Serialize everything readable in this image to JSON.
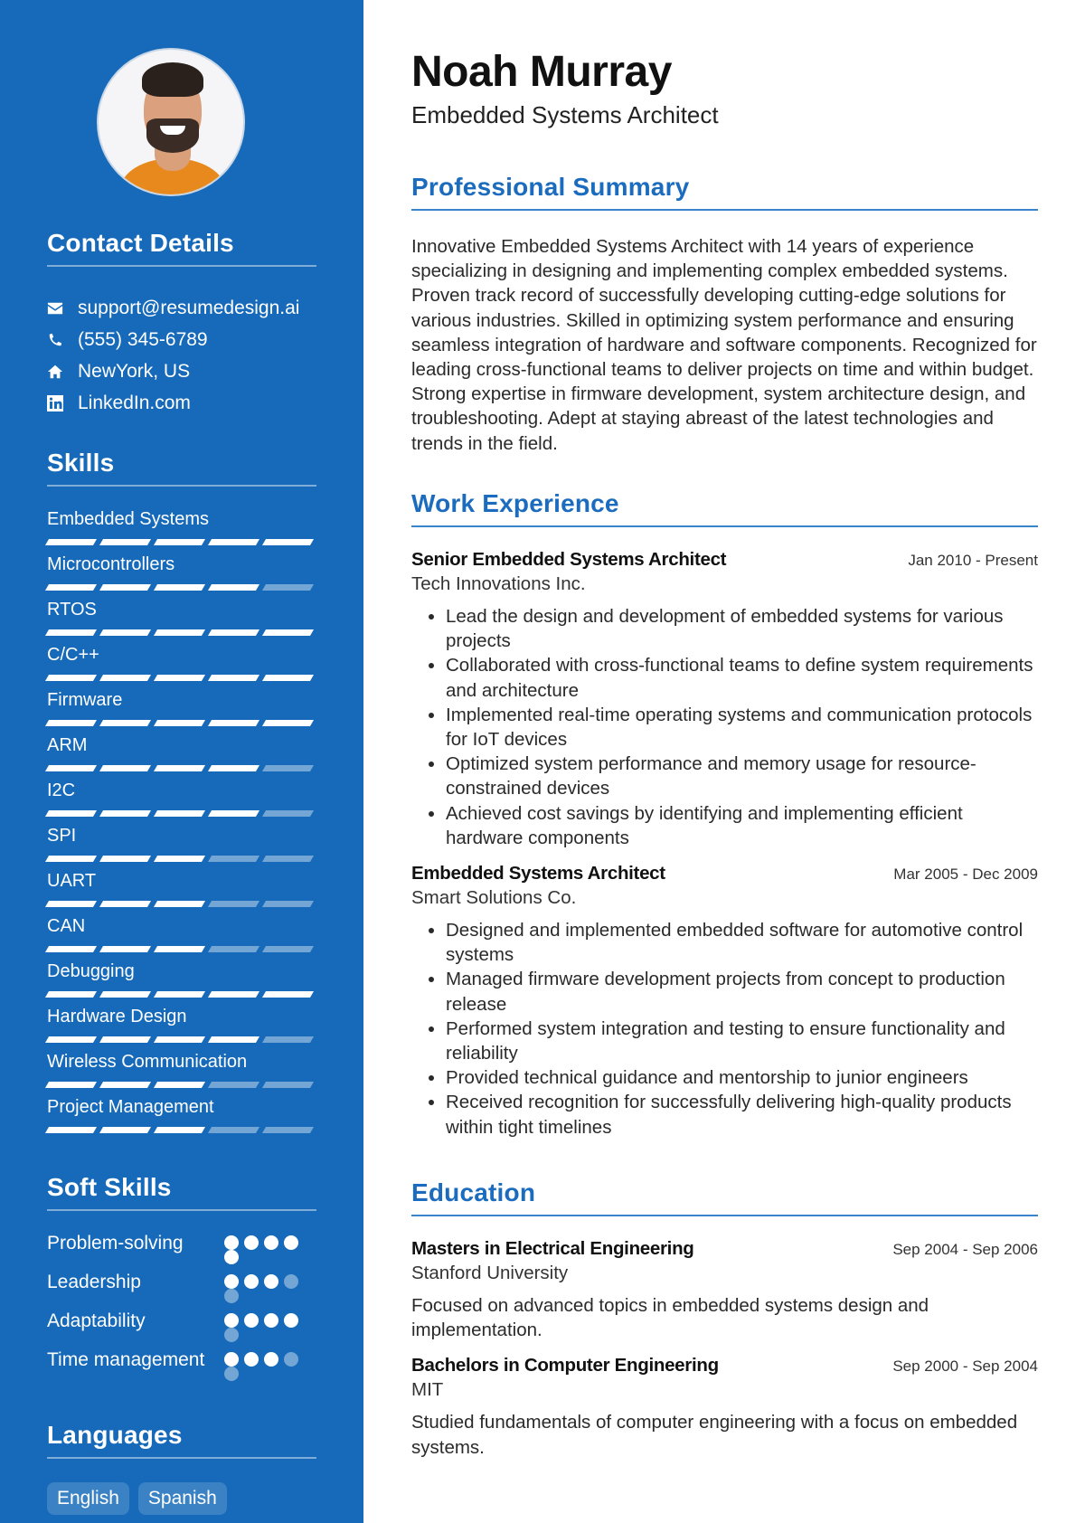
{
  "profile": {
    "name": "Noah Murray",
    "role": "Embedded Systems Architect",
    "photo_alt": "Profile photo of a smiling man with a beard wearing an orange shirt"
  },
  "contact": {
    "title": "Contact Details",
    "items": [
      {
        "icon": "envelope-icon",
        "text": "support@resumedesign.ai"
      },
      {
        "icon": "phone-icon",
        "text": "(555) 345-6789"
      },
      {
        "icon": "home-icon",
        "text": "NewYork, US"
      },
      {
        "icon": "linkedin-icon",
        "text": "LinkedIn.com"
      }
    ]
  },
  "skills": {
    "title": "Skills",
    "max": 5,
    "items": [
      {
        "name": "Embedded Systems",
        "level": 5
      },
      {
        "name": "Microcontrollers",
        "level": 4
      },
      {
        "name": "RTOS",
        "level": 5
      },
      {
        "name": "C/C++",
        "level": 5
      },
      {
        "name": "Firmware",
        "level": 5
      },
      {
        "name": "ARM",
        "level": 4
      },
      {
        "name": "I2C",
        "level": 4
      },
      {
        "name": "SPI",
        "level": 3
      },
      {
        "name": "UART",
        "level": 3
      },
      {
        "name": "CAN",
        "level": 3
      },
      {
        "name": "Debugging",
        "level": 5
      },
      {
        "name": "Hardware Design",
        "level": 4
      },
      {
        "name": "Wireless Communication",
        "level": 3
      },
      {
        "name": "Project Management",
        "level": 3
      }
    ]
  },
  "soft_skills": {
    "title": "Soft Skills",
    "max": 5,
    "items": [
      {
        "name": "Problem-solving",
        "level": 5
      },
      {
        "name": "Leadership",
        "level": 3
      },
      {
        "name": "Adaptability",
        "level": 4
      },
      {
        "name": "Time management",
        "level": 3
      }
    ]
  },
  "languages": {
    "title": "Languages",
    "items": [
      "English",
      "Spanish"
    ]
  },
  "summary": {
    "title": "Professional Summary",
    "text": "Innovative Embedded Systems Architect with 14 years of experience specializing in designing and implementing complex embedded systems. Proven track record of successfully developing cutting-edge solutions for various industries. Skilled in optimizing system performance and ensuring seamless integration of hardware and software components. Recognized for leading cross-functional teams to deliver projects on time and within budget. Strong expertise in firmware development, system architecture design, and troubleshooting. Adept at staying abreast of the latest technologies and trends in the field."
  },
  "experience": {
    "title": "Work Experience",
    "jobs": [
      {
        "title": "Senior Embedded Systems Architect",
        "dates": "Jan 2010 - Present",
        "company": "Tech Innovations Inc.",
        "bullets": [
          "Lead the design and development of embedded systems for various projects",
          "Collaborated with cross-functional teams to define system requirements and architecture",
          "Implemented real-time operating systems and communication protocols for IoT devices",
          "Optimized system performance and memory usage for resource-constrained devices",
          "Achieved cost savings by identifying and implementing efficient hardware components"
        ]
      },
      {
        "title": "Embedded Systems Architect",
        "dates": "Mar 2005 - Dec 2009",
        "company": "Smart Solutions Co.",
        "bullets": [
          "Designed and implemented embedded software for automotive control systems",
          "Managed firmware development projects from concept to production release",
          "Performed system integration and testing to ensure functionality and reliability",
          "Provided technical guidance and mentorship to junior engineers",
          "Received recognition for successfully delivering high-quality products within tight timelines"
        ]
      }
    ]
  },
  "education": {
    "title": "Education",
    "items": [
      {
        "degree": "Masters in Electrical Engineering",
        "dates": "Sep 2004 - Sep 2006",
        "school": "Stanford University",
        "description": "Focused on advanced topics in embedded systems design and implementation."
      },
      {
        "degree": "Bachelors in Computer Engineering",
        "dates": "Sep 2000 - Sep 2004",
        "school": "MIT",
        "description": "Studied fundamentals of computer engineering with a focus on embedded systems."
      }
    ]
  },
  "colors": {
    "sidebar_bg": "#166ab9",
    "accent": "#1b6cbf",
    "text": "#2a2a2a"
  }
}
